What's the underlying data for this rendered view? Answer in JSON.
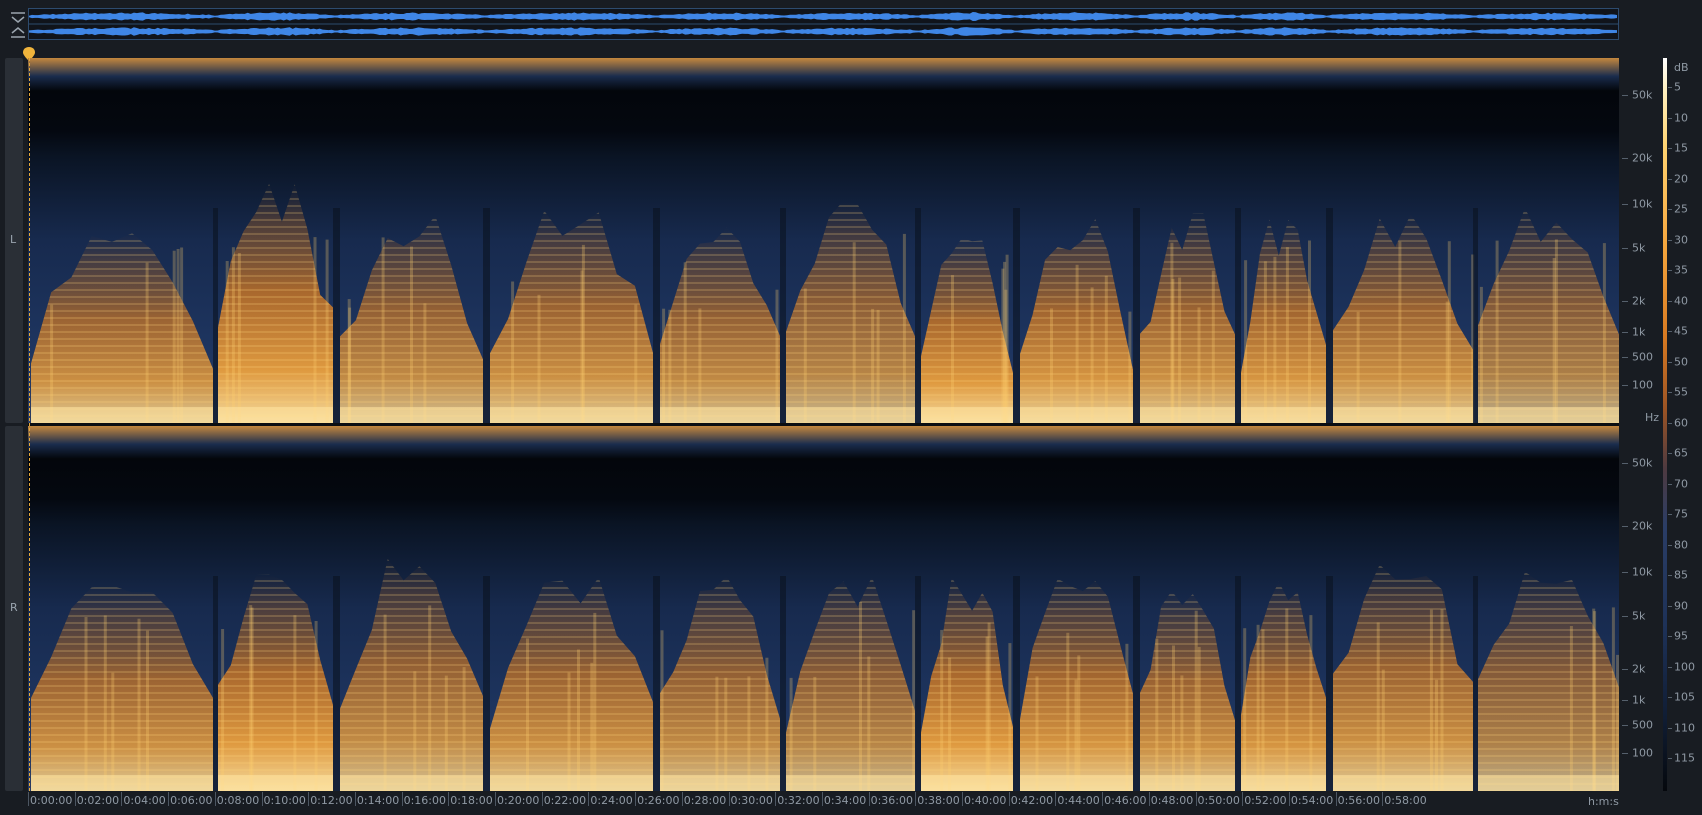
{
  "overview": {
    "collapse_icon": "chevron-collapse-icon",
    "expand_icon": "chevron-expand-icon",
    "waveform_color": "#3f86e6",
    "border_color": "#2d4b6e"
  },
  "playhead": {
    "color": "#e6a93a",
    "time": "0:00:00"
  },
  "channels": [
    {
      "id": "l",
      "label": "L"
    },
    {
      "id": "r",
      "label": "R"
    }
  ],
  "frequency_axis": {
    "unit": "Hz",
    "labels": [
      "50k",
      "20k",
      "10k",
      "5k",
      "2k",
      "1k",
      "500",
      "100"
    ]
  },
  "db_scale": {
    "unit": "dB",
    "labels": [
      "5",
      "10",
      "15",
      "20",
      "25",
      "30",
      "35",
      "40",
      "45",
      "50",
      "55",
      "60",
      "65",
      "70",
      "75",
      "80",
      "85",
      "90",
      "95",
      "100",
      "105",
      "110",
      "115"
    ]
  },
  "time_axis": {
    "unit": "h:m:s",
    "labels": [
      "0:00:00",
      "0:02:00",
      "0:04:00",
      "0:06:00",
      "0:08:00",
      "0:10:00",
      "0:12:00",
      "0:14:00",
      "0:16:00",
      "0:18:00",
      "0:20:00",
      "0:22:00",
      "0:24:00",
      "0:26:00",
      "0:28:00",
      "0:30:00",
      "0:32:00",
      "0:34:00",
      "0:36:00",
      "0:38:00",
      "0:40:00",
      "0:42:00",
      "0:44:00",
      "0:46:00",
      "0:48:00",
      "0:50:00",
      "0:52:00",
      "0:54:00",
      "0:56:00",
      "0:58:00"
    ]
  },
  "spectrogram": {
    "colors": {
      "low": "#0a1424",
      "mid": "#1e3560",
      "warm": "#d67a20",
      "hot": "#ffe3a0"
    }
  }
}
